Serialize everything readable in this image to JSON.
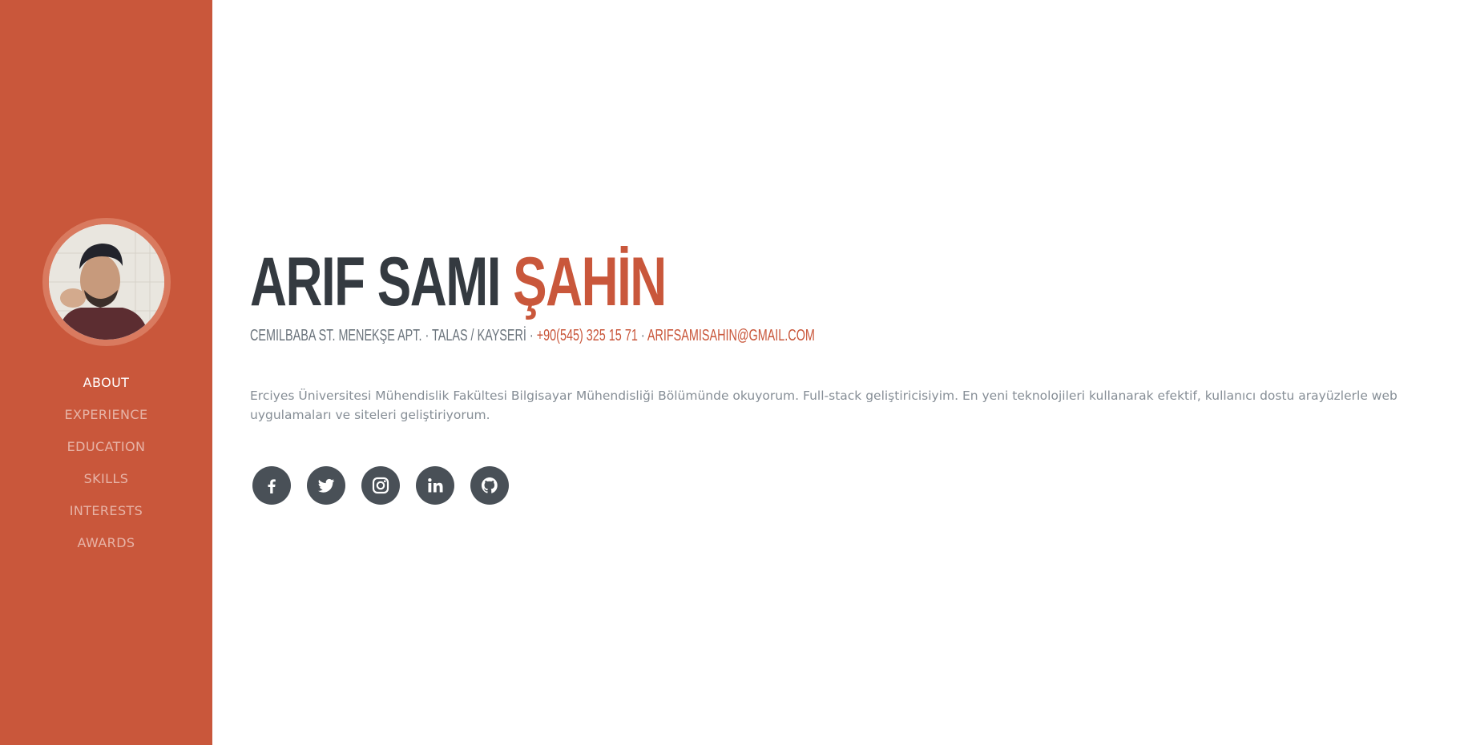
{
  "profile": {
    "first_name": "ARIF SAMI",
    "last_name": "ŞAHİN",
    "address": "CEMILBABA ST. MENEKŞE APT. · TALAS / KAYSERİ ·",
    "phone": "+90(545) 325 15 71",
    "separator": "·",
    "email": "ARIFSAMISAHIN@GMAIL.COM",
    "bio": "Erciyes Üniversitesi Mühendislik Fakültesi Bilgisayar Mühendisliği Bölümünde okuyorum. Full-stack geliştiricisiyim. En yeni teknolojileri kullanarak efektif, kullanıcı dostu arayüzlerle web uygulamaları ve siteleri geliştiriyorum."
  },
  "nav": {
    "items": [
      {
        "label": "ABOUT",
        "active": true
      },
      {
        "label": "EXPERIENCE",
        "active": false
      },
      {
        "label": "EDUCATION",
        "active": false
      },
      {
        "label": "SKILLS",
        "active": false
      },
      {
        "label": "INTERESTS",
        "active": false
      },
      {
        "label": "AWARDS",
        "active": false
      }
    ]
  },
  "socials": [
    {
      "icon": "facebook-icon"
    },
    {
      "icon": "twitter-icon"
    },
    {
      "icon": "instagram-icon"
    },
    {
      "icon": "linkedin-icon"
    },
    {
      "icon": "github-icon"
    }
  ],
  "colors": {
    "accent": "#c9573b",
    "heading": "#343a40",
    "muted": "#868e96",
    "social_bg": "#495057"
  }
}
